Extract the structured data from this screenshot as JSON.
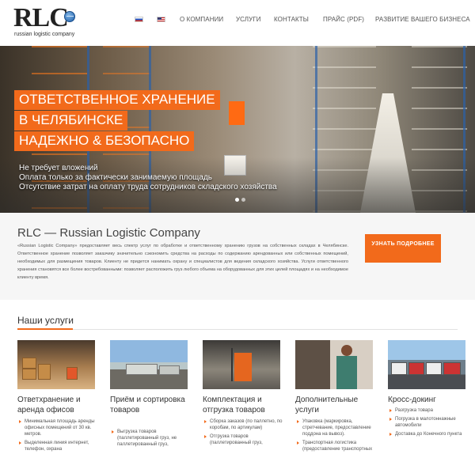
{
  "header": {
    "logo_text": "RLC",
    "logo_tagline": "russian logistic company",
    "lang_flags": [
      "ru-flag-icon",
      "us-flag-icon"
    ],
    "nav": [
      "О КОМПАНИИ",
      "УСЛУГИ",
      "КОНТАКТЫ",
      "ПРАЙС (PDF)",
      "РАЗВИТИЕ ВАШЕГО БИЗНЕСА"
    ]
  },
  "hero": {
    "title_lines": [
      "ОТВЕТСТВЕННОЕ ХРАНЕНИЕ",
      "В ЧЕЛЯБИНСКЕ",
      "НАДЕЖНО & БЕЗОПАСНО"
    ],
    "bullets": [
      "Не требует вложений",
      "Оплата только за фактически занимаемую площадь",
      "Отсутствие затрат на оплату труда сотрудников складского хозяйства"
    ],
    "slider_dots": 2,
    "active_dot": 0
  },
  "about": {
    "title": "RLC — Russian Logistic Company",
    "text": "«Russian Logistic Company» предоставляет весь спектр услуг по обработке и ответственному хранению грузов на собственных складах в Челябинске. Ответственное хранение позволяет заказчику значительно сэкономить средства на расходы по содержанию арендованных или собственных помещений, необходимых для размещения товаров. Клиенту не придется нанимать охрану и специалистов для ведения складского хозяйства. Услуги ответственного хранения становятся все более востребованными: позволяет расположить груз любого объема на оборудованных для этих целей площадях и на необходимое клиенту время.",
    "cta_label": "УЗНАТЬ ПОДРОБНЕЕ"
  },
  "services": {
    "heading": "Наши услуги",
    "cards": [
      {
        "title": "Ответхранение и аренда офисов",
        "items": [
          "Минимальная площадь аренды офисных помещений от 30 кв. метров.",
          "Выделенная линия интернет, телефон, охрана"
        ]
      },
      {
        "title": "Приём и сортировка товаров",
        "items": [
          "Выгрузка товаров (паллетированный груз, не паллетированный груз,"
        ]
      },
      {
        "title": "Комплектация и отгрузка товаров",
        "items": [
          "Сборка заказов (по паллетно, по коробам, по артикулам)",
          "Отгрузка товаров (паллетированный груз,"
        ]
      },
      {
        "title": "Дополнительные услуги",
        "items": [
          "Упаковка (маркировка, стретчевание, предоставление поддона на вывоз).",
          "Транспортная логистика (предоставление транспортных"
        ]
      },
      {
        "title": "Кросс-докинг",
        "items": [
          "Разгрузка товара",
          "Погрузка в малотоннажные автомобили",
          "Доставка до Конечного пункта"
        ]
      }
    ]
  },
  "colors": {
    "accent": "#f26a1b",
    "text": "#333333",
    "about_bg": "#f6f6f6"
  }
}
